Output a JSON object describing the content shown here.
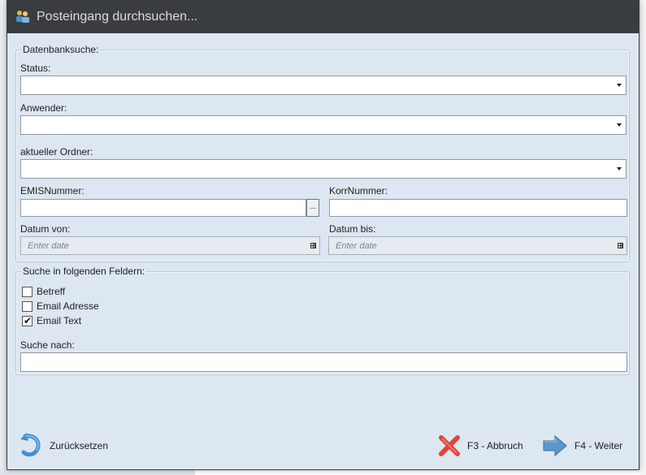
{
  "dialog": {
    "title": "Posteingang durchsuchen...",
    "icon": "users-search-icon"
  },
  "database_search": {
    "legend": "Datenbanksuche:",
    "status_label": "Status:",
    "status_value": "",
    "user_label": "Anwender:",
    "user_value": "",
    "folder_label": "aktueller Ordner:",
    "folder_value": "",
    "emis_label": "EMISNummer:",
    "emis_value": "",
    "emis_browse_label": "...",
    "korr_label": "KorrNummer:",
    "korr_value": "",
    "date_from_label": "Datum von:",
    "date_from_placeholder": "Enter date",
    "date_to_label": "Datum bis:",
    "date_to_placeholder": "Enter date"
  },
  "field_search": {
    "legend": "Suche in folgenden Feldern:",
    "fields": [
      {
        "label": "Betreff",
        "checked": false
      },
      {
        "label": "Email Adresse",
        "checked": false
      },
      {
        "label": "Email Text",
        "checked": true
      }
    ],
    "search_label": "Suche nach:",
    "search_value": ""
  },
  "footer": {
    "reset_label": "Zurücksetzen",
    "cancel_label": "F3 - Abbruch",
    "next_label": "F4 - Weiter"
  },
  "colors": {
    "titlebar": "#3a3d3f",
    "dialog_bg": "#dde7f1",
    "reset_icon": "#3e8fd6",
    "cancel_icon": "#e0453a",
    "next_icon": "#5b97c9"
  }
}
